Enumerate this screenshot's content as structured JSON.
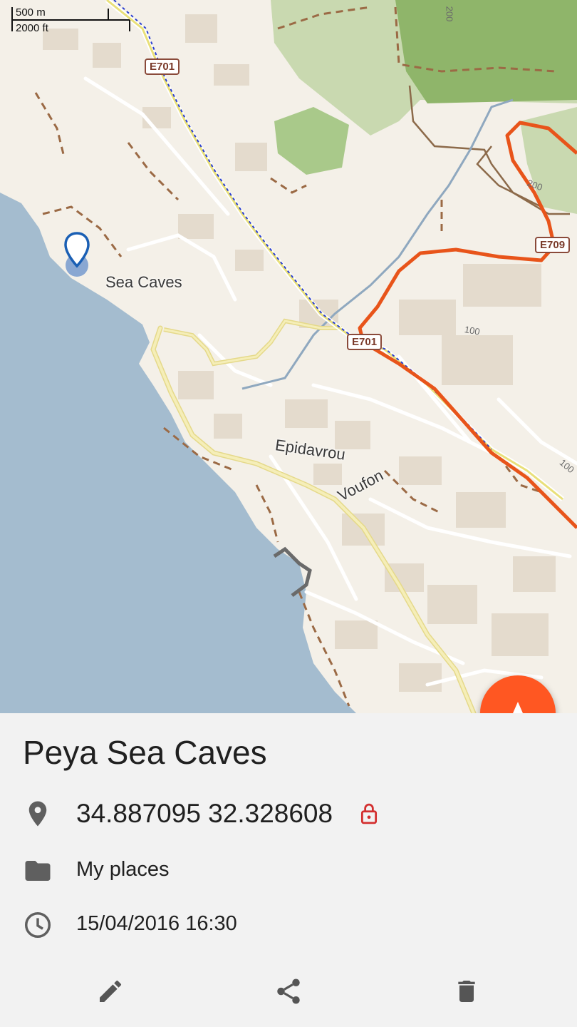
{
  "map": {
    "scale_metric": "500 m",
    "scale_imperial": "2000 ft",
    "place_label": "Sea Caves",
    "street_labels": [
      "Epidavrou",
      "Voufon"
    ],
    "road_shields": [
      "E701",
      "E701",
      "E709"
    ],
    "contour_labels": [
      "200",
      "200",
      "100",
      "100"
    ],
    "colors": {
      "sea": "#a4bccf",
      "land": "#f4f0e8",
      "forest": "#8fb56a",
      "primary_road": "#e8541a",
      "secondary_road": "#f1e9a9",
      "marker": "#1a5fb4"
    }
  },
  "fab": {
    "icon": "navigate-arrow-icon",
    "color": "#ff5722"
  },
  "details": {
    "title": "Peya Sea Caves",
    "coordinates": "34.887095 32.328608",
    "coordinates_icon": "location-pin-icon",
    "lock_icon": "lock-icon",
    "folder": "My places",
    "folder_icon": "folder-icon",
    "datetime": "15/04/2016 16:30",
    "datetime_icon": "clock-icon"
  },
  "toolbar": {
    "edit_icon": "edit-icon",
    "share_icon": "share-icon",
    "delete_icon": "delete-icon"
  }
}
